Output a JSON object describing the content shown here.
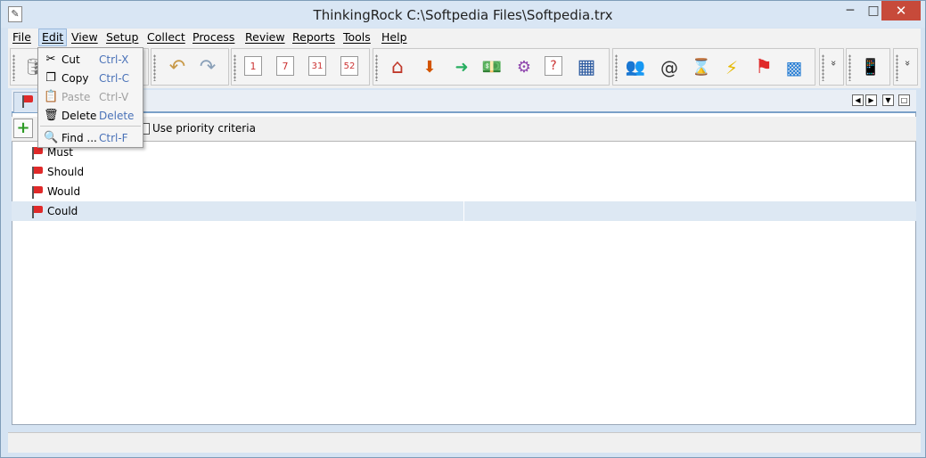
{
  "window": {
    "title": "ThinkingRock C:\\Softpedia Files\\Softpedia.trx",
    "minimize": "─",
    "maximize": "□",
    "close": "✕"
  },
  "menubar": {
    "items": [
      {
        "label": "File"
      },
      {
        "label": "Edit"
      },
      {
        "label": "View"
      },
      {
        "label": "Setup"
      },
      {
        "label": "Collect"
      },
      {
        "label": "Process"
      },
      {
        "label": "Review"
      },
      {
        "label": "Reports"
      },
      {
        "label": "Tools"
      },
      {
        "label": "Help"
      }
    ]
  },
  "edit_menu": {
    "items": [
      {
        "label": "Cut",
        "shortcut": "Ctrl-X",
        "icon": "scissors-icon",
        "glyph": "✂",
        "enabled": true
      },
      {
        "label": "Copy",
        "shortcut": "Ctrl-C",
        "icon": "copy-icon",
        "glyph": "❐",
        "enabled": true
      },
      {
        "label": "Paste",
        "shortcut": "Ctrl-V",
        "icon": "paste-icon",
        "glyph": "📋",
        "enabled": false
      },
      {
        "label": "Delete",
        "shortcut": "Delete",
        "icon": "trash-icon",
        "glyph": "🗑",
        "enabled": true
      },
      {
        "label": "Find ...",
        "shortcut": "Ctrl-F",
        "icon": "magnifier-icon",
        "glyph": "🔍",
        "enabled": true
      }
    ]
  },
  "toolbar": {
    "icons": [
      {
        "name": "database-icon",
        "glyph": "🛢"
      },
      {
        "name": "undo-icon",
        "glyph": "↶"
      },
      {
        "name": "redo-icon",
        "glyph": "↷"
      },
      {
        "name": "calendar-day-icon",
        "glyph": "1"
      },
      {
        "name": "calendar-week-icon",
        "glyph": "7"
      },
      {
        "name": "calendar-month-icon",
        "glyph": "31"
      },
      {
        "name": "calendar-year-icon",
        "glyph": "52"
      },
      {
        "name": "home-icon",
        "glyph": "⌂"
      },
      {
        "name": "inbox-in-icon",
        "glyph": "⬇"
      },
      {
        "name": "inbox-out-icon",
        "glyph": "➜"
      },
      {
        "name": "money-icon",
        "glyph": "💵"
      },
      {
        "name": "process-thoughts-icon",
        "glyph": "⚙"
      },
      {
        "name": "question-calendar-icon",
        "glyph": "?"
      },
      {
        "name": "filing-cabinet-icon",
        "glyph": "▦"
      },
      {
        "name": "contacts-icon",
        "glyph": "👥"
      },
      {
        "name": "at-icon",
        "glyph": "@"
      },
      {
        "name": "hourglass-icon",
        "glyph": "⌛"
      },
      {
        "name": "lightning-icon",
        "glyph": "⚡"
      },
      {
        "name": "flag-icon",
        "glyph": "⚑"
      },
      {
        "name": "blocks-icon",
        "glyph": "▩"
      },
      {
        "name": "phone-icon",
        "glyph": "📱"
      }
    ],
    "chevron": "»"
  },
  "tabstrip": {
    "prev": "◀",
    "next": "▶",
    "menu": "▼",
    "maximize": "□"
  },
  "subtoolbar": {
    "add_label": "+",
    "priority_label": "Use priority criteria"
  },
  "list": {
    "rows": [
      {
        "label": "Must"
      },
      {
        "label": "Should"
      },
      {
        "label": "Would"
      },
      {
        "label": "Could",
        "selected": true
      }
    ]
  }
}
